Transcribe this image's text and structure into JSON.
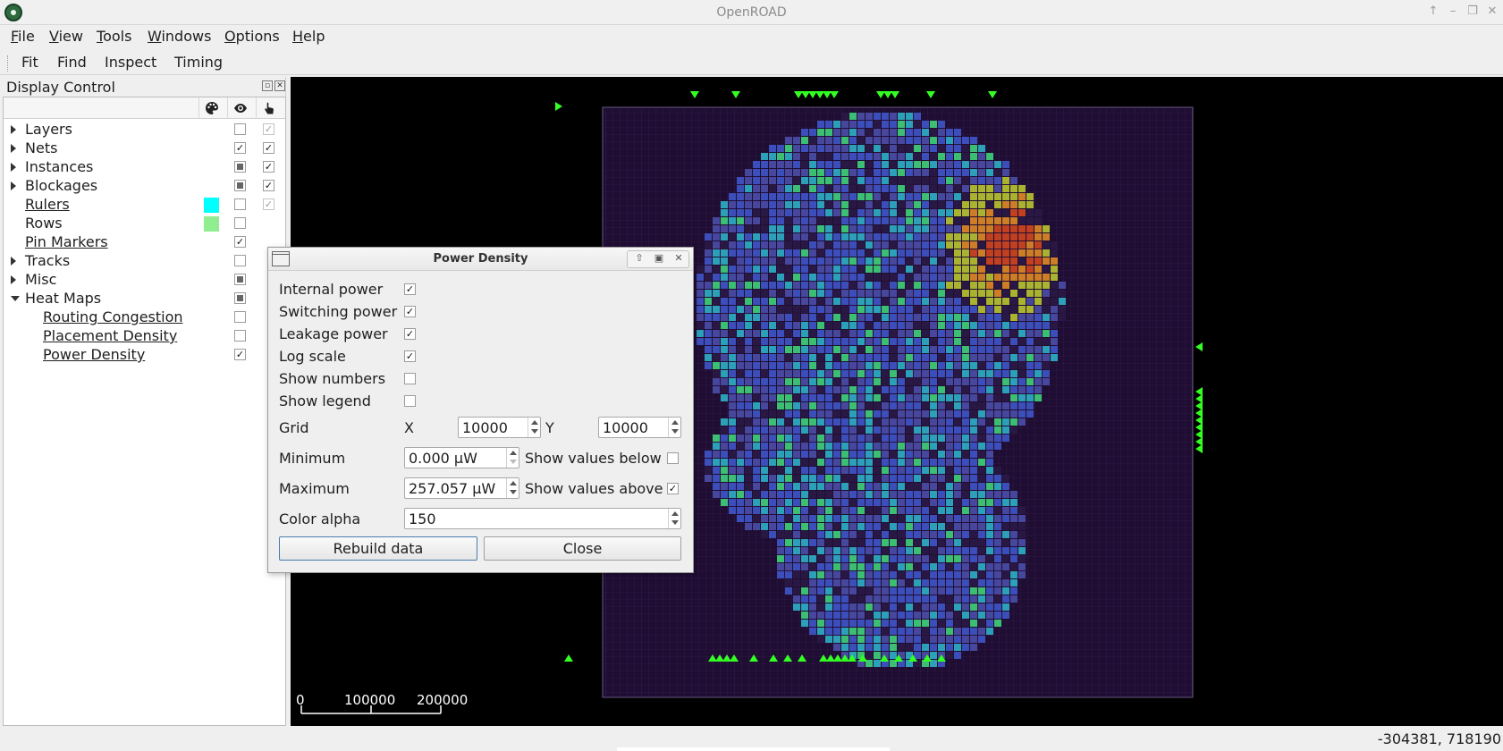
{
  "window": {
    "title": "OpenROAD",
    "controls": [
      "↑",
      "–",
      "❐",
      "✕"
    ]
  },
  "menubar": [
    {
      "label": "File",
      "u": "F",
      "rest": "ile"
    },
    {
      "label": "View",
      "u": "V",
      "rest": "iew"
    },
    {
      "label": "Tools",
      "u": "T",
      "rest": "ools"
    },
    {
      "label": "Windows",
      "u": "W",
      "rest": "indows"
    },
    {
      "label": "Options",
      "u": "O",
      "rest": "ptions"
    },
    {
      "label": "Help",
      "u": "H",
      "rest": "elp"
    }
  ],
  "toolbar": {
    "fit": "Fit",
    "find": "Find",
    "inspect": "Inspect",
    "timing": "Timing"
  },
  "display_control": {
    "title": "Display Control",
    "header_icons": [
      "palette-icon",
      "eye-icon",
      "pointer-icon"
    ],
    "items": [
      {
        "label": "Layers",
        "expander": "right",
        "link": false,
        "swatch": null,
        "visible": "empty",
        "select": "dim-checked"
      },
      {
        "label": "Nets",
        "expander": "right",
        "link": false,
        "swatch": null,
        "visible": "checked",
        "select": "checked"
      },
      {
        "label": "Instances",
        "expander": "right",
        "link": false,
        "swatch": null,
        "visible": "partial",
        "select": "checked"
      },
      {
        "label": "Blockages",
        "expander": "right",
        "link": false,
        "swatch": null,
        "visible": "partial",
        "select": "checked"
      },
      {
        "label": "Rulers",
        "expander": null,
        "link": true,
        "swatch": "#00ffff",
        "visible": "empty",
        "select": "dim-checked"
      },
      {
        "label": "Rows",
        "expander": null,
        "link": false,
        "swatch": "#90ee90",
        "visible": "empty",
        "select": null
      },
      {
        "label": "Pin Markers",
        "expander": null,
        "link": true,
        "swatch": null,
        "visible": "checked",
        "select": null
      },
      {
        "label": "Tracks",
        "expander": "right",
        "link": false,
        "swatch": null,
        "visible": "empty",
        "select": null
      },
      {
        "label": "Misc",
        "expander": "right",
        "link": false,
        "swatch": null,
        "visible": "partial",
        "select": null
      },
      {
        "label": "Heat Maps",
        "expander": "down",
        "link": false,
        "swatch": null,
        "visible": "partial",
        "select": null
      },
      {
        "label": "Routing Congestion",
        "expander": null,
        "child": true,
        "link": true,
        "swatch": null,
        "visible": "empty",
        "select": null
      },
      {
        "label": "Placement Density",
        "expander": null,
        "child": true,
        "link": true,
        "swatch": null,
        "visible": "empty",
        "select": null
      },
      {
        "label": "Power Density",
        "expander": null,
        "child": true,
        "link": true,
        "swatch": null,
        "visible": "checked",
        "select": null
      }
    ]
  },
  "dialog": {
    "title": "Power Density",
    "options": [
      {
        "label": "Internal power",
        "checked": true
      },
      {
        "label": "Switching power",
        "checked": true
      },
      {
        "label": "Leakage power",
        "checked": true
      },
      {
        "label": "Log scale",
        "checked": true
      },
      {
        "label": "Show numbers",
        "checked": false
      },
      {
        "label": "Show legend",
        "checked": false
      }
    ],
    "grid_label": "Grid",
    "grid_x_label": "X",
    "grid_x": "10000",
    "grid_y_label": "Y",
    "grid_y": "10000",
    "minimum_label": "Minimum",
    "minimum": "0.000 µW",
    "show_below_label": "Show values below",
    "show_below": false,
    "maximum_label": "Maximum",
    "maximum": "257.057 µW",
    "show_above_label": "Show values above",
    "show_above": true,
    "alpha_label": "Color alpha",
    "alpha": "150",
    "rebuild_label": "Rebuild data",
    "close_label": "Close"
  },
  "scale_bar": {
    "ticks": [
      "0",
      "100000",
      "200000"
    ]
  },
  "status": {
    "coords": "-304381, 718190"
  },
  "colors": {
    "die_fill": "#1f0d33",
    "heat_blue": "#3f55c8",
    "heat_green": "#3fd27a",
    "heat_red": "#d2461e",
    "pin_marker": "#33ff22"
  }
}
